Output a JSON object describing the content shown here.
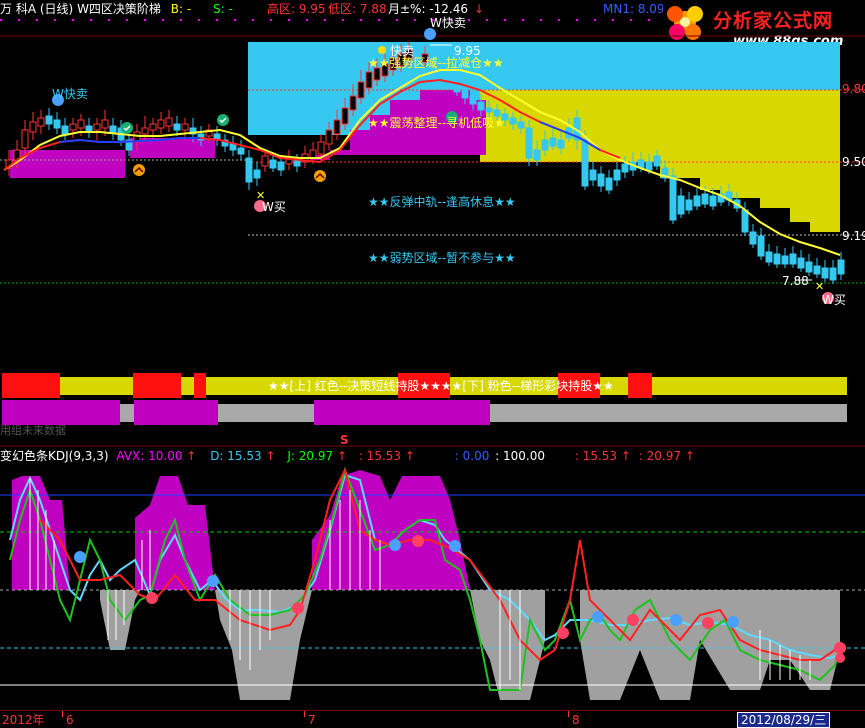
{
  "header": {
    "stock_name": "万 科A",
    "period": "(日线)",
    "indicator_name": "W四区决策阶梯",
    "b_label": "B: -",
    "s_label": "S: -",
    "high_label": "高区: 9.95",
    "low_label": "低区: 7.88",
    "change_label": "月±%: -12.46",
    "change_arrow": "↓",
    "mn_label": "MN1: 8.09"
  },
  "logo": {
    "name": "分析家公式网",
    "url": "www.88gs.com"
  },
  "price_axis": {
    "labels": [
      "9.80",
      "9.50",
      "9.19"
    ]
  },
  "zone_labels": {
    "strong": "★★强势区域--拉减仓★★",
    "shock": "★★震荡整理--寻机低吸★",
    "rebound": "★★反弹中轨--逢高休息★★",
    "weak": "★★弱势区域--暂不参与★★"
  },
  "signals": {
    "w_sell_1": "W快卖",
    "w_sell_2": "W快卖",
    "w_buy_1": "W买",
    "w_buy_2": "W买",
    "high_price": "9.95",
    "low_price": "7.88",
    "high_marker": "快卖"
  },
  "strip": {
    "text": "★★[上] 红色--决策短线持股★★★★[下] 粉色--梯形彩块持股★★",
    "caption": "用组未来数据"
  },
  "kdj_header": {
    "name": "变幻色条KDJ(9,3,3)",
    "avx": "AVX: 10.00",
    "d": "D: 15.53",
    "j": "J: 20.97",
    "v1": ": 15.53",
    "v2": ": 0.00",
    "v3": ": 100.00",
    "v4": ": 15.53",
    "v5": ": 20.97",
    "s_marker": "S",
    "up_arrow": "↑"
  },
  "date_axis": {
    "year": "2012年",
    "months": [
      "6",
      "7",
      "8"
    ],
    "cursor_date": "2012/08/29/三"
  },
  "colors": {
    "up": "#ff3333",
    "down": "#35c8f0",
    "cyan_zone": "#35c8f0",
    "yellow_zone": "#d8d800",
    "magenta": "#c000c0",
    "gray": "#a0a0a0",
    "kdj_blue": "#3060ff"
  }
}
